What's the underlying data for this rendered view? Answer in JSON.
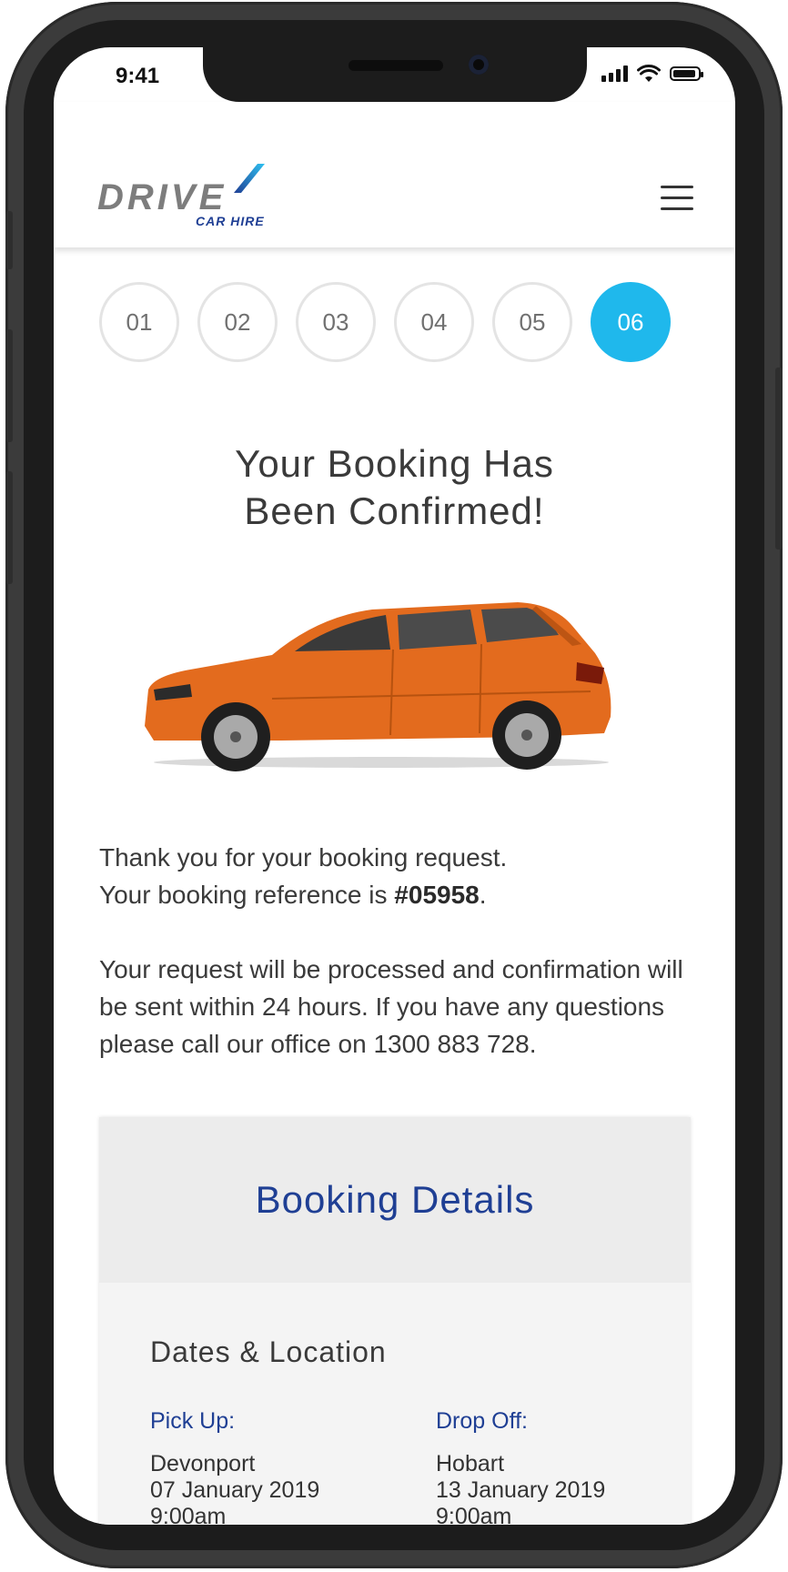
{
  "status_bar": {
    "time": "9:41"
  },
  "header": {
    "logo_text": "DRIVE",
    "logo_subtext": "CAR HIRE"
  },
  "steps": [
    "01",
    "02",
    "03",
    "04",
    "05",
    "06"
  ],
  "active_step": "06",
  "title_line1": "Your Booking Has",
  "title_line2": "Been Confirmed!",
  "car": {
    "color": "#e36b1e"
  },
  "message": {
    "line1": "Thank you for your booking request.",
    "ref_prefix": "Your booking reference is ",
    "ref_number": "#05958",
    "ref_suffix": ".",
    "paragraph2": "Your request will be processed and confirmation will be sent within 24 hours. If you have any questions please call our office on 1300 883 728."
  },
  "booking_details": {
    "heading": "Booking Details",
    "section": "Dates & Location",
    "pickup": {
      "label": "Pick Up:",
      "location": "Devonport",
      "date": "07 January 2019",
      "time": "9:00am"
    },
    "dropoff": {
      "label": "Drop Off:",
      "location": "Hobart",
      "date": "13 January 2019",
      "time": "9:00am"
    }
  },
  "colors": {
    "accent_blue": "#1fb8ec",
    "navy": "#1f3f94"
  }
}
